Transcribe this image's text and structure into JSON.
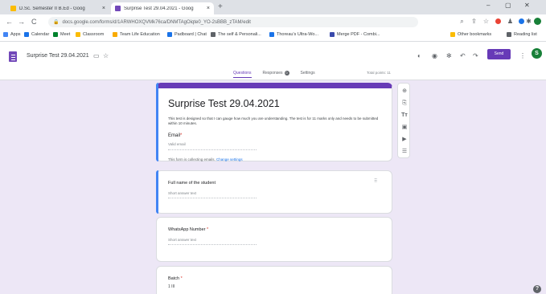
{
  "browser": {
    "tabs": [
      {
        "title": "D.Sc. Semester II B.Ed - Goog",
        "close": "×",
        "color": "#fbbc04"
      },
      {
        "title": "Surprise Test 29.04.2021 - Goog",
        "close": "×",
        "color": "#7248b9"
      }
    ],
    "new_tab": "+",
    "window_controls": {
      "minimize": "–",
      "maximize": "▢",
      "close": "✕"
    },
    "nav": {
      "back": "←",
      "forward": "→",
      "reload": "C"
    },
    "url": "docs.google.com/forms/d/1ARWHOXQVMk76ca/DNMTAgOiqte0_YO-2sBBB_zTAM/edit",
    "lock": "🔒",
    "bookmarks": [
      {
        "label": "Apps",
        "color": "#4285f4"
      },
      {
        "label": "Calendar",
        "color": "#1a73e8"
      },
      {
        "label": "Meet",
        "color": "#00832d"
      },
      {
        "label": "Classroom",
        "color": "#fbbc04"
      },
      {
        "label": "Team Life Education",
        "color": "#f9ab00"
      },
      {
        "label": "Padboard | Chat",
        "color": "#1a73e8"
      },
      {
        "label": "The self & Personali...",
        "color": "#5f6368"
      },
      {
        "label": "Thoreau's Ultra-Wo...",
        "color": "#1a73e8"
      },
      {
        "label": "Merge PDF - Combi...",
        "color": "#3949ab"
      },
      {
        "label": "Other bookmarks",
        "color": "#fbbc04"
      },
      {
        "label": "Reading list",
        "color": "#5f6368"
      }
    ]
  },
  "forms_header": {
    "title": "Surprise Test 29.04.2021",
    "send_label": "Send",
    "avatar_letter": "S",
    "tabs": {
      "questions": "Questions",
      "responses": "Responses",
      "responses_count": "0",
      "settings": "Settings"
    },
    "total_points": "Total points: 11"
  },
  "form": {
    "title": "Surprise Test 29.04.2021",
    "description": "This test is designed so that I can gauge how much you are understanding. The test is for 11 marks only and needs to be submitted within 10 minutes.",
    "email_label": "Email",
    "required_mark": "*",
    "email_placeholder": "Valid email",
    "collect_note": "This form is collecting emails.",
    "change_settings": "Change settings"
  },
  "questions": [
    {
      "label": "Full name of the student",
      "placeholder": "Short answer text",
      "required": ""
    },
    {
      "label": "WhatsApp Number",
      "placeholder": "Short answer text",
      "required": "*"
    },
    {
      "label": "Batch",
      "option": "1  III",
      "required": "*"
    }
  ],
  "floating_toolbar": [
    "add-icon",
    "import-icon",
    "title-icon",
    "image-icon",
    "video-icon",
    "section-icon"
  ],
  "help_icon": "?"
}
